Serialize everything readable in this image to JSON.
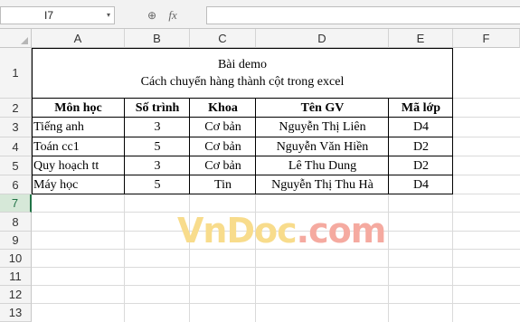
{
  "formula_bar": {
    "name_box": "I7",
    "name_box_arrow": "▾",
    "zoom_icon": "⊕",
    "fx_label": "fx",
    "formula": ""
  },
  "columns": [
    "A",
    "B",
    "C",
    "D",
    "E",
    "F"
  ],
  "rows": [
    "1",
    "2",
    "3",
    "4",
    "5",
    "6",
    "7",
    "8",
    "9",
    "10",
    "11",
    "12",
    "13"
  ],
  "sheet": {
    "title": "Bài demo",
    "subtitle": "Cách chuyển hàng thành cột trong excel",
    "headers": [
      "Môn học",
      "Số trình",
      "Khoa",
      "Tên GV",
      "Mã lớp"
    ],
    "data": [
      [
        "Tiếng anh",
        "3",
        "Cơ bản",
        "Nguyễn Thị Liên",
        "D4"
      ],
      [
        "Toán cc1",
        "5",
        "Cơ bản",
        "Nguyễn Văn Hiền",
        "D2"
      ],
      [
        "Quy hoạch tt",
        "3",
        "Cơ bản",
        "Lê Thu Dung",
        "D2"
      ],
      [
        "Máy học",
        "5",
        "Tin",
        "Nguyễn Thị Thu Hà",
        "D4"
      ]
    ]
  },
  "watermark": {
    "part1": "VnDoc",
    "part2": ".com"
  },
  "colors": {
    "selection": "#217346",
    "grid": "#dadada",
    "header_bg": "#f4f4f4"
  }
}
